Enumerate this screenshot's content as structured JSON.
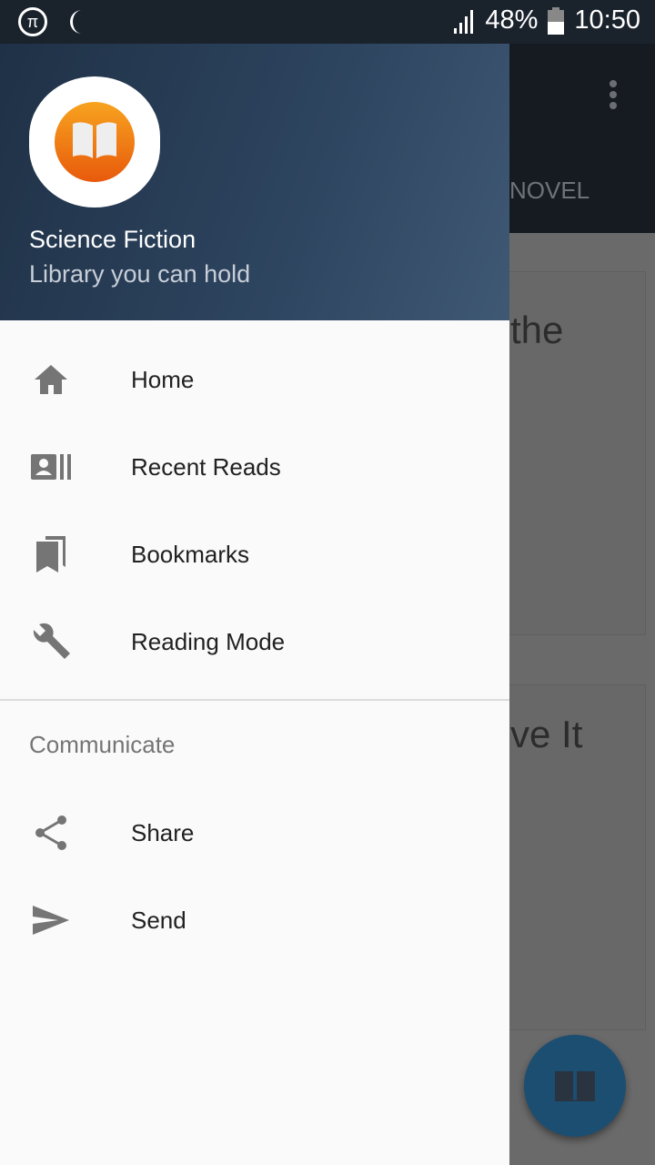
{
  "status_bar": {
    "battery": "48%",
    "time": "10:50",
    "icons": [
      "pi-icon",
      "moon-icon",
      "signal-icon",
      "battery-icon"
    ]
  },
  "background": {
    "tab_label": "NOVEL",
    "card1_title_fragment": "the",
    "card2_title_fragment": "ve It"
  },
  "drawer": {
    "header": {
      "title": "Science Fiction",
      "subtitle": "Library you can hold"
    },
    "items": [
      {
        "label": "Home",
        "icon": "home-icon"
      },
      {
        "label": "Recent Reads",
        "icon": "contacts-icon"
      },
      {
        "label": "Bookmarks",
        "icon": "bookmarks-icon"
      },
      {
        "label": "Reading Mode",
        "icon": "wrench-icon"
      }
    ],
    "section_title": "Communicate",
    "section_items": [
      {
        "label": "Share",
        "icon": "share-icon"
      },
      {
        "label": "Send",
        "icon": "send-icon"
      }
    ]
  },
  "colors": {
    "header_start": "#1e3045",
    "header_end": "#3f5873",
    "fab": "#1c4e72",
    "icon": "#757575"
  }
}
